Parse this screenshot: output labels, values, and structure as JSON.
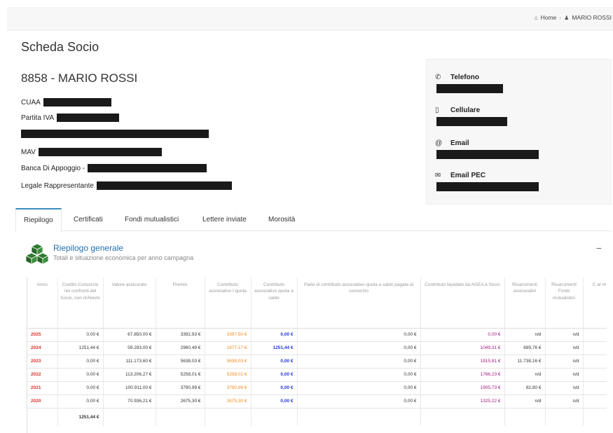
{
  "breadcrumb": {
    "home": "Home",
    "current": "MARIO ROSSI"
  },
  "page_title": "Scheda Socio",
  "socio": {
    "title": "8858 - MARIO ROSSI",
    "fields": [
      {
        "label": "CUAA"
      },
      {
        "label": "Partita IVA"
      },
      {
        "label": ""
      },
      {
        "label": "MAV"
      },
      {
        "label": "Banca Di Appoggio -"
      },
      {
        "label": "Legale Rappresentante"
      }
    ]
  },
  "contacts": {
    "telefono": "Telefono",
    "cellulare": "Cellulare",
    "email": "Email",
    "email_pec": "Email PEC"
  },
  "tabs": [
    "Riepilogo",
    "Certificati",
    "Fondi mutualistici",
    "Lettere inviate",
    "Morosità"
  ],
  "panel": {
    "title": "Riepilogo generale",
    "subtitle": "Totali e situazione economica per anno campagna",
    "collapse": "−"
  },
  "table": {
    "headers": [
      "Anno",
      "Credito Consorzio nei confronti del Socio, non richiesto",
      "Valore assicurato",
      "Premio",
      "Contributo associativo I quota",
      "Contributo associativo quota a saldo",
      "Parte di contributo associativo quota a saldo pagata al consorzio",
      "Contributo liquidato da AGEA a Socio",
      "Risarcimenti assicurativi",
      "Risarcimenti Fondi mutualistici",
      "C ar m"
    ],
    "rows": [
      [
        "2025",
        "0,00 €",
        "67.850,00 €",
        "3392,93 €",
        "3397,50 €",
        "0,00 €",
        "0,00 €",
        "0,00 €",
        "n/d",
        "n/d",
        ""
      ],
      [
        "2024",
        "1251,44 €",
        "59.293,00 €",
        "2960,49 €",
        "1877,17 €",
        "1251,44 €",
        "0,00 €",
        "1049,31 €",
        "699,76 €",
        "n/d",
        ""
      ],
      [
        "2023",
        "0,00 €",
        "111.173,60 €",
        "5638,03 €",
        "5638,03 €",
        "0,00 €",
        "0,00 €",
        "1915,81 €",
        "11.738,16 €",
        "n/d",
        ""
      ],
      [
        "2022",
        "0,00 €",
        "113.206,27 €",
        "5258,01 €",
        "5258,01 €",
        "0,00 €",
        "0,00 €",
        "1766,23 €",
        "n/d",
        "n/d",
        ""
      ],
      [
        "2021",
        "0,00 €",
        "100.911,00 €",
        "3790,99 €",
        "3790,99 €",
        "0,00 €",
        "0,00 €",
        "1905,73 €",
        "82,80 €",
        "n/d",
        ""
      ],
      [
        "2020",
        "0,00 €",
        "70.936,21 €",
        "2675,30 €",
        "2675,30 €",
        "0,00 €",
        "0,00 €",
        "1325,22 €",
        "n/d",
        "n/d",
        ""
      ]
    ],
    "total": [
      "",
      "1251,44 €",
      "",
      "",
      "",
      "",
      "",
      "",
      "",
      "",
      ""
    ]
  },
  "colors": {
    "accent": "#3c8dbc",
    "year_red": "#d9312b",
    "orange": "#ef8a1d",
    "blue": "#2434d6",
    "purple": "#a3177e",
    "cube_green": "#2f7a2f"
  },
  "icons": {
    "home": "home-icon",
    "breadcrumb_item": "user-icon",
    "telefono": "phone-icon",
    "cellulare": "mobile-icon",
    "email": "at-icon",
    "email_pec": "envelope-icon",
    "panel": "cubes-icon"
  }
}
